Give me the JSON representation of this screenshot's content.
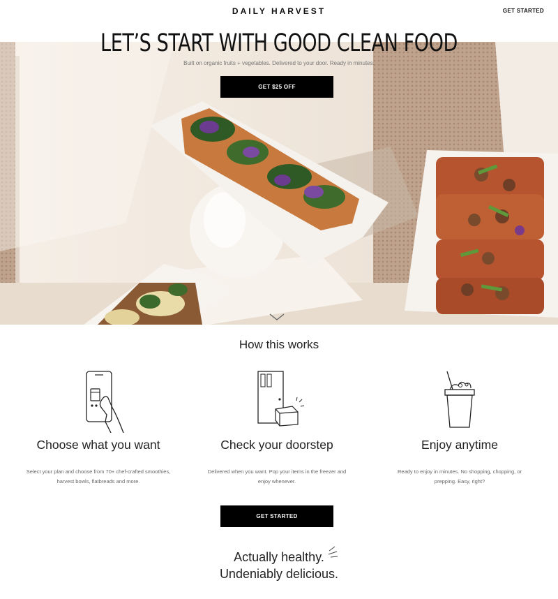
{
  "header": {
    "brand": "DAILY HARVEST",
    "cta_label": "GET STARTED"
  },
  "hero": {
    "headline": "LET’S START WITH GOOD CLEAN FOOD",
    "subtitle": "Built on organic fruits + vegetables. Delivered to your door. Ready in minutes.",
    "cta_label": "GET $25 OFF",
    "scroll_icon": "chevron-down-icon"
  },
  "how_it_works": {
    "title": "How this works",
    "steps": [
      {
        "icon": "phone-hand-icon",
        "title": "Choose what you want",
        "description": "Select your plan and choose from 70+ chef-crafted smoothies, harvest bowls, flatbreads and more."
      },
      {
        "icon": "door-package-icon",
        "title": "Check your doorstep",
        "description": "Delivered when you want. Pop your items in the freezer and enjoy whenever."
      },
      {
        "icon": "smoothie-cup-icon",
        "title": "Enjoy anytime",
        "description": "Ready to enjoy in minutes. No shopping, chopping, or prepping. Easy, right?"
      }
    ],
    "cta_label": "GET STARTED"
  },
  "tagline": {
    "line1": "Actually healthy.",
    "line2": "Undeniably delicious."
  },
  "colors": {
    "button_bg": "#000000",
    "button_text": "#ffffff",
    "hero_backdrop": "#efe6dc"
  }
}
